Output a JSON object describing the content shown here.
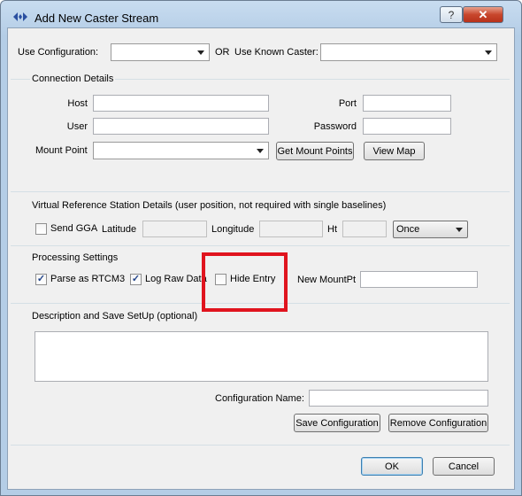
{
  "window": {
    "title": "Add New Caster Stream",
    "help_btn": "?",
    "close_btn": "✕"
  },
  "top": {
    "use_config_label": "Use Configuration:",
    "or_label": "OR",
    "known_caster_label": "Use Known Caster:",
    "use_config_value": "",
    "known_caster_value": ""
  },
  "connection": {
    "title": "Connection Details",
    "host_label": "Host",
    "host_value": "",
    "port_label": "Port",
    "port_value": "",
    "user_label": "User",
    "user_value": "",
    "password_label": "Password",
    "password_value": "",
    "mount_label": "Mount Point",
    "mount_value": "",
    "get_mount_points": "Get Mount Points",
    "view_map": "View Map"
  },
  "vrs": {
    "title": "Virtual Reference Station Details (user position, not required with single baselines)",
    "send_gga": "Send GGA",
    "latitude": "Latitude",
    "longitude": "Longitude",
    "ht": "Ht",
    "frequency": "Once"
  },
  "processing": {
    "title": "Processing Settings",
    "parse_rtcm3": "Parse as RTCM3",
    "log_raw": "Log Raw Data",
    "hide_entry": "Hide Entry",
    "new_mountpt": "New MountPt",
    "parse_checked": "✓",
    "log_checked": "✓"
  },
  "description": {
    "title": "Description and Save SetUp (optional)",
    "config_name_label": "Configuration Name:",
    "save_config": "Save Configuration",
    "remove_config": "Remove Configuration"
  },
  "footer": {
    "ok": "OK",
    "cancel": "Cancel"
  },
  "colors": {
    "highlight": "#e0141e",
    "titlebar": "#b4cde6"
  }
}
